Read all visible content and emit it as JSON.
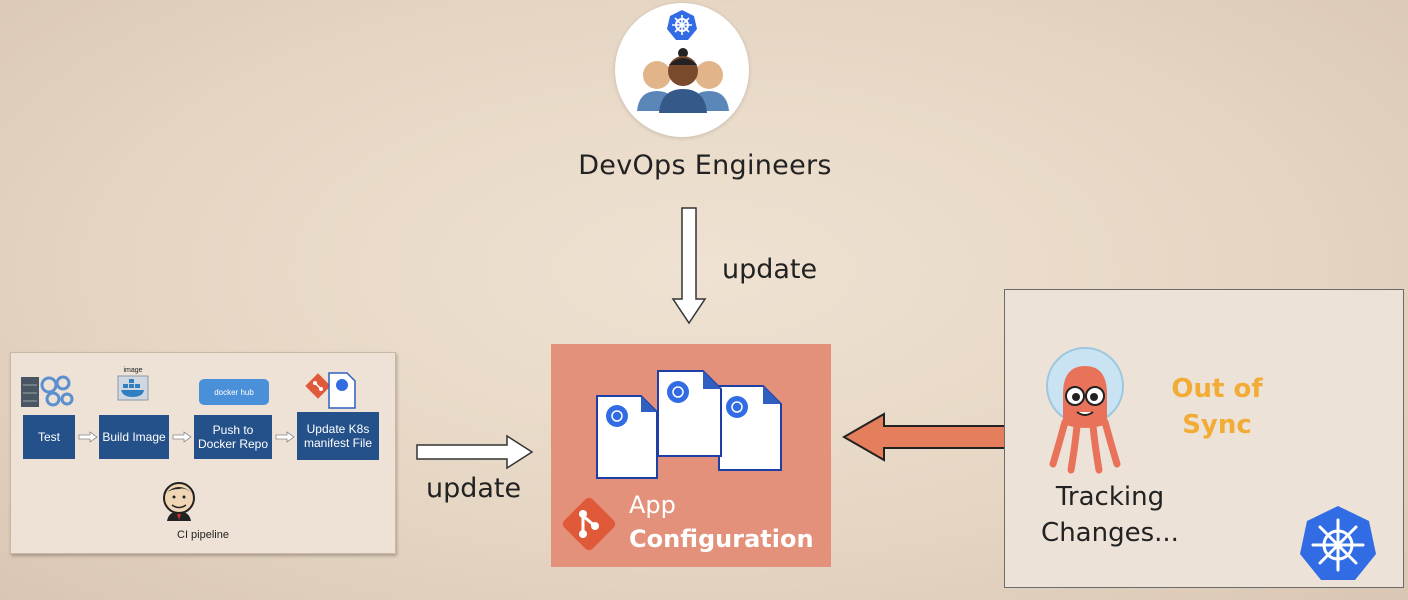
{
  "devops": {
    "label": "DevOps Engineers",
    "icon": "devops-team-icon"
  },
  "flows": {
    "top_update": "update",
    "left_update": "update"
  },
  "ci_pipeline": {
    "steps": [
      "Test",
      "Build Image",
      "Push to Docker Repo",
      "Update K8s manifest File"
    ],
    "image_tag": "image",
    "docker_hub_label": "docker hub",
    "label": "CI pipeline"
  },
  "app_config": {
    "line1": "App",
    "line2": "Configuration",
    "color": "#e3917b"
  },
  "argocd": {
    "status_line1": "Out of",
    "status_line2": "Sync",
    "tracking_line1": "Tracking",
    "tracking_line2": "Changes...",
    "status_color": "#f2ac35"
  },
  "colors": {
    "k8s_blue": "#326ce5",
    "pipeline_blue": "#24518a",
    "argo_arrow": "#e47e5c"
  }
}
